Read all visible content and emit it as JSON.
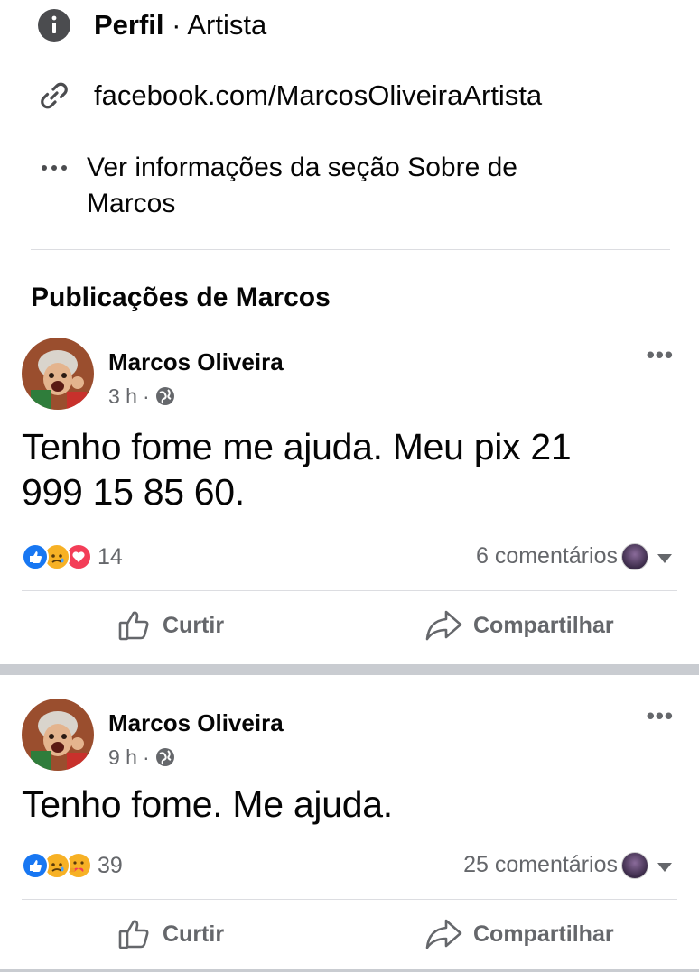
{
  "profile_info": {
    "type_label": "Perfil",
    "type_separator": " · ",
    "type_value": "Artista",
    "link": "facebook.com/MarcosOliveiraArtista",
    "about_text_line1": "Ver informações da seção Sobre de",
    "about_text_line2": "Marcos"
  },
  "section_title": "Publicações de Marcos",
  "posts": [
    {
      "author": "Marcos Oliveira",
      "time": "3 h",
      "text_line1": "Tenho fome me ajuda. Meu pix 21",
      "text_line2": "999 15 85 60.",
      "reaction_count": "14",
      "comments": "6 comentários",
      "reactions": [
        "like",
        "sad",
        "love"
      ]
    },
    {
      "author": "Marcos Oliveira",
      "time": "9 h",
      "text_line1": "Tenho fome. Me ajuda.",
      "reaction_count": "39",
      "comments": "25 comentários",
      "reactions": [
        "like",
        "sad",
        "care"
      ]
    }
  ],
  "actions": {
    "like_label": "Curtir",
    "share_label": "Compartilhar"
  },
  "colors": {
    "like_blue": "#1877f2",
    "love_red": "#f33e58",
    "reaction_yellow": "#f7b125",
    "secondary_text": "#65676b"
  }
}
